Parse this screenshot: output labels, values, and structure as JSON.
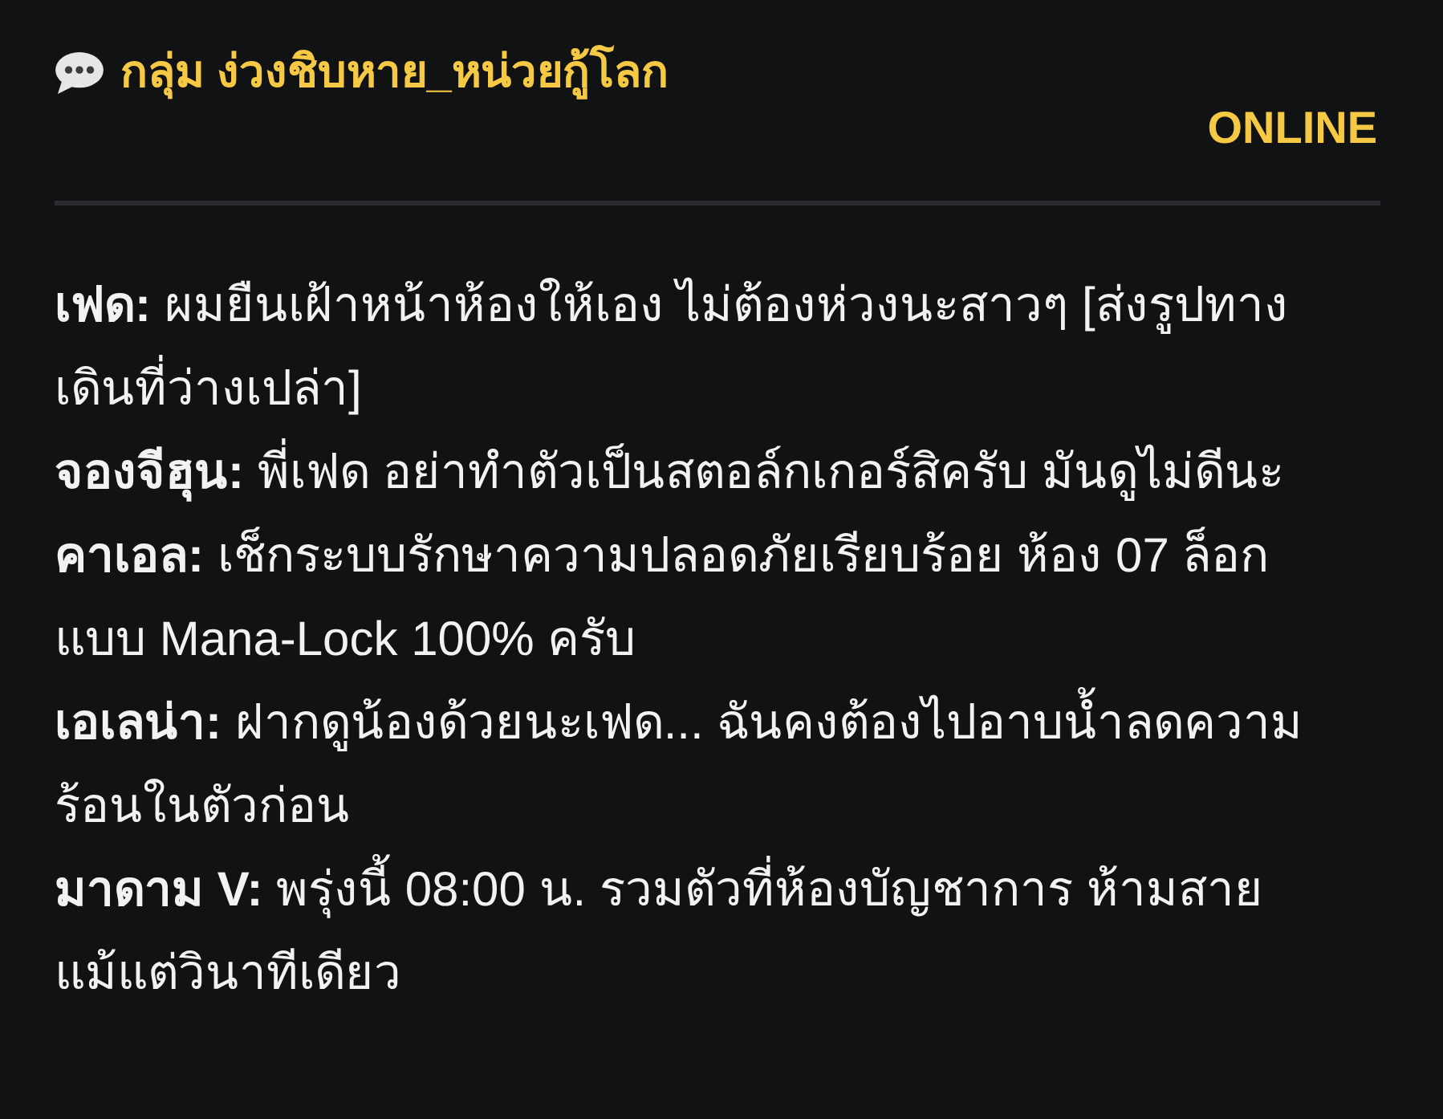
{
  "header": {
    "title": "กลุ่ม ง่วงชิบหาย_หน่วยกู้โลก",
    "status": "ONLINE"
  },
  "messages": [
    {
      "text": "**เฟด:** ผมยืนเฝ้าหน้าห้องให้เอง ไม่ต้องห่วงนะสาวๆ [ส่งรูปทางเดินที่ว่างเปล่า]"
    },
    {
      "text": "**จองจีฮุน:** พี่เฟด อย่าทำตัวเป็นสตอล์กเกอร์สิครับ มันดูไม่ดีนะ"
    },
    {
      "text": "**คาเอล:** เช็กระบบรักษาความปลอดภัยเรียบร้อย ห้อง 07 ล็อกแบบ Mana-Lock 100% ครับ"
    },
    {
      "text": "**เอเลน่า:** ฝากดูน้องด้วยนะเฟด... ฉันคงต้องไปอาบน้ำลดความร้อนในตัวก่อน"
    },
    {
      "text": "**มาดาม V:** พรุ่งนี้ 08:00 น. รวมตัวที่ห้องบัญชาการ ห้ามสายแม้แต่วินาทีเดียว"
    }
  ]
}
